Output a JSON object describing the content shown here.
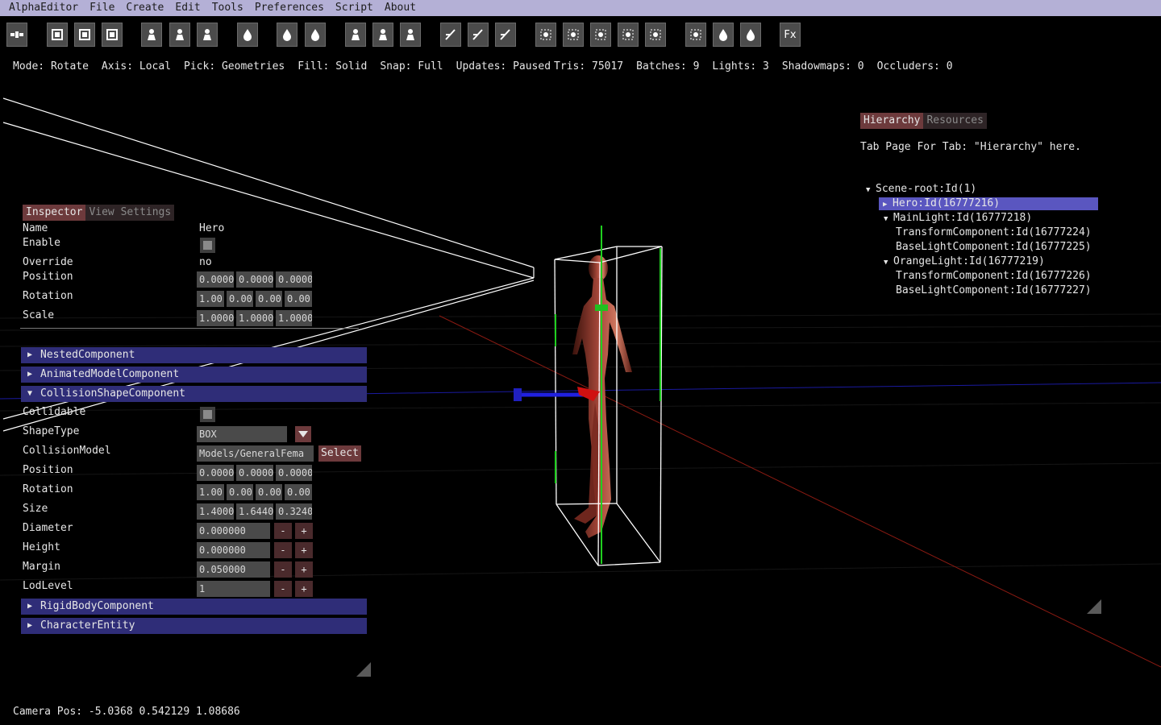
{
  "menu": [
    "AlphaEditor",
    "File",
    "Create",
    "Edit",
    "Tools",
    "Preferences",
    "Script",
    "About"
  ],
  "toolbar_icons": [
    "node-graph-icon",
    "play-icon",
    "split-view-icon",
    "frame-icon",
    "bone-select-icon",
    "bone-move-icon",
    "bone-rotate-icon",
    "light-icon",
    "spot-light-icon",
    "point-light-icon",
    "rig-icon-1",
    "rig-icon-2",
    "rig-icon-3",
    "axis-x-icon",
    "axis-y-icon",
    "axis-z-icon",
    "focus-icon",
    "grid-snap-icon",
    "target-icon",
    "link-icon",
    "layers-icon",
    "particles-icon",
    "light-bulb-icon",
    "light-probe-icon",
    "fx-icon"
  ],
  "fx_label": "Fx",
  "status": {
    "mode": "Mode: Rotate",
    "axis": "Axis: Local",
    "pick": "Pick: Geometries",
    "fill": "Fill: Solid",
    "snap": "Snap: Full",
    "updates": "Updates: Paused",
    "tris": "Tris: 75017",
    "batches": "Batches: 9",
    "lights": "Lights: 3",
    "shadowmaps": "Shadowmaps: 0",
    "occluders": "Occluders: 0"
  },
  "inspector": {
    "tabs": [
      "Inspector",
      "View Settings"
    ],
    "name_label": "Name",
    "name_value": "Hero",
    "enable_label": "Enable",
    "override_label": "Override",
    "override_value": "no",
    "position_label": "Position",
    "position": [
      "0.0000",
      "0.0000",
      "0.0000"
    ],
    "rotation_label": "Rotation",
    "rotation": [
      "1.00",
      "0.00",
      "0.00",
      "0.00"
    ],
    "scale_label": "Scale",
    "scale": [
      "1.0000",
      "1.0000",
      "1.0000"
    ],
    "components_top": [
      "NestedComponent",
      "AnimatedModelComponent"
    ],
    "collision": {
      "title": "CollisionShapeComponent",
      "collidable_label": "Collidable",
      "shape_type_label": "ShapeType",
      "shape_type_value": "BOX",
      "model_label": "CollisionModel",
      "model_value": "Models/GeneralFema",
      "select_label": "Select",
      "position_label": "Position",
      "position": [
        "0.0000",
        "0.0000",
        "0.0000"
      ],
      "rotation_label": "Rotation",
      "rotation": [
        "1.00",
        "0.00",
        "0.00",
        "0.00"
      ],
      "size_label": "Size",
      "size": [
        "1.4000",
        "1.6440",
        "0.3240"
      ],
      "diameter_label": "Diameter",
      "diameter_value": "0.000000",
      "height_label": "Height",
      "height_value": "0.000000",
      "margin_label": "Margin",
      "margin_value": "0.050000",
      "lod_label": "LodLevel",
      "lod_value": "1",
      "minus": "-",
      "plus": "+"
    },
    "components_bottom": [
      "RigidBodyComponent",
      "CharacterEntity"
    ]
  },
  "hierarchy": {
    "tabs": [
      "Hierarchy",
      "Resources"
    ],
    "caption": "Tab Page For Tab: \"Hierarchy\" here.",
    "tree": [
      {
        "label": "Scene-root:Id(1)",
        "expanded": true
      },
      {
        "label": "Hero:Id(16777216)",
        "expanded": false,
        "selected": true
      },
      {
        "label": "MainLight:Id(16777218)",
        "expanded": true
      },
      {
        "label": "TransformComponent:Id(16777224)"
      },
      {
        "label": "BaseLightComponent:Id(16777225)"
      },
      {
        "label": "OrangeLight:Id(16777219)",
        "expanded": true
      },
      {
        "label": "TransformComponent:Id(16777226)"
      },
      {
        "label": "BaseLightComponent:Id(16777227)"
      }
    ]
  },
  "camera_pos": "Camera Pos: -5.0368 0.542129 1.08686",
  "colors": {
    "menubar": "#b4b0d6",
    "tab_active": "#6d3a3c",
    "component_header": "#2f2d78",
    "tree_selected": "#5a56c0"
  }
}
